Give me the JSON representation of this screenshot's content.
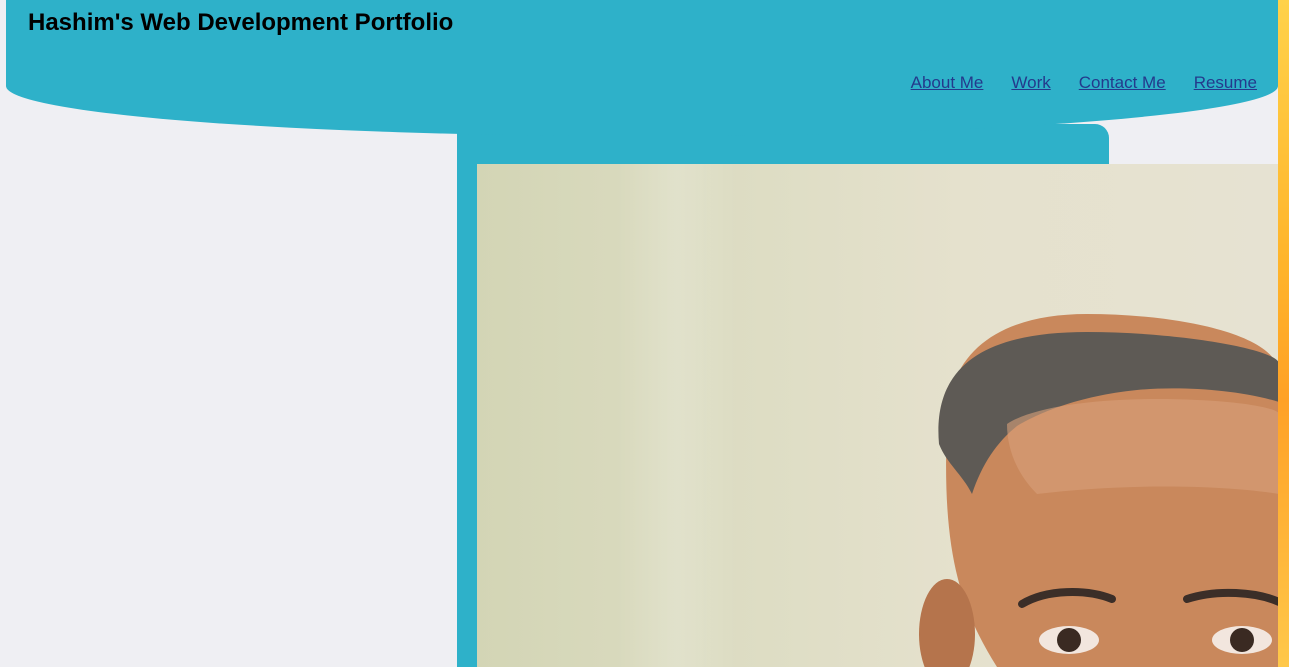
{
  "header": {
    "title": "Hashim's Web Development Portfolio",
    "nav": [
      {
        "label": "About Me"
      },
      {
        "label": "Work"
      },
      {
        "label": "Contact Me"
      },
      {
        "label": "Resume"
      }
    ]
  },
  "colors": {
    "header_bg": "#2eb1c9",
    "page_bg": "#efeff3",
    "nav_link": "#243a8c",
    "accent_strip": "#ffb42a"
  },
  "main": {
    "photo": {
      "icon": "profile-photo"
    }
  }
}
